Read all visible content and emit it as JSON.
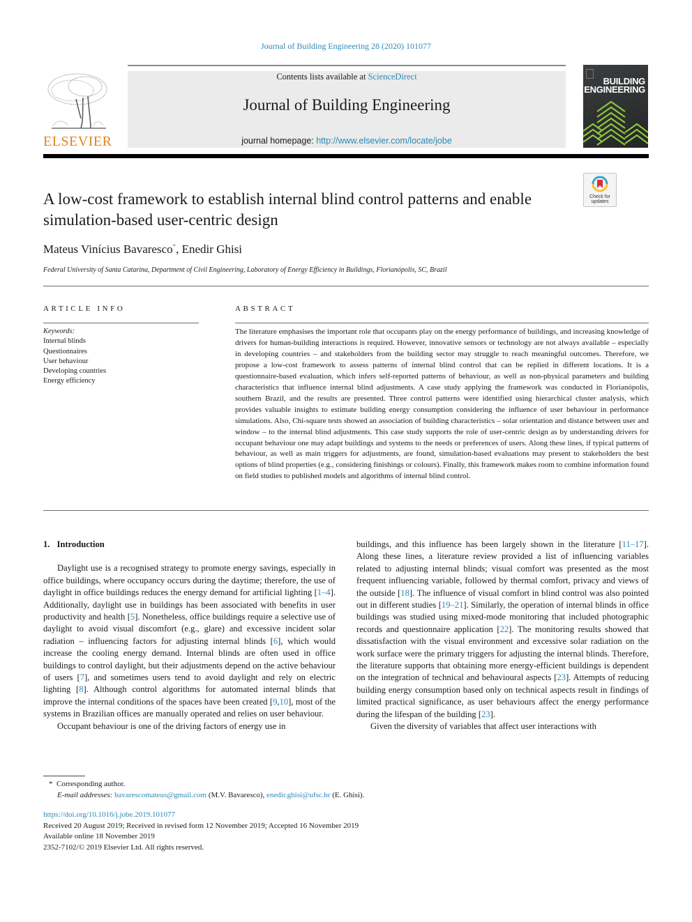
{
  "header": {
    "journal_reference": "Journal of Building Engineering 28 (2020) 101077",
    "publisher_logo": "ELSEVIER",
    "contents_prefix": "Contents lists available at ",
    "contents_link": "ScienceDirect",
    "journal_title": "Journal of Building Engineering",
    "homepage_prefix": "journal homepage: ",
    "homepage_url": "http://www.elsevier.com/locate/jobe",
    "cover_title_line1": "BUILDING",
    "cover_title_line2": "ENGINEERING",
    "crossmark_label_1": "Check for",
    "crossmark_label_2": "updates"
  },
  "article": {
    "title": "A low-cost framework to establish internal blind control patterns and enable simulation-based user-centric design",
    "authors": [
      {
        "name": "Mateus Vinícius Bavaresco",
        "mark": "*"
      },
      {
        "name": "Enedir Ghisi",
        "mark": ""
      }
    ],
    "author_separator": ", ",
    "affiliation": "Federal University of Santa Catarina, Department of Civil Engineering, Laboratory of Energy Efficiency in Buildings, Florianópolis, SC, Brazil"
  },
  "article_info": {
    "heading": "ARTICLE INFO",
    "keywords_label": "Keywords:",
    "keywords": [
      "Internal blinds",
      "Questionnaires",
      "User behaviour",
      "Developing countries",
      "Energy efficiency"
    ]
  },
  "abstract": {
    "heading": "ABSTRACT",
    "text": "The literature emphasises the important role that occupants play on the energy performance of buildings, and increasing knowledge of drivers for human-building interactions is required. However, innovative sensors or technology are not always available – especially in developing countries – and stakeholders from the building sector may struggle to reach meaningful outcomes. Therefore, we propose a low-cost framework to assess pat­terns of internal blind control that can be replied in different locations. It is a questionnaire-based evaluation, which infers self-reported patterns of behaviour, as well as non-physical parameters and building characteristics that influence internal blind adjustments. A case study applying the framework was conducted in Florianópolis, southern Brazil, and the results are presented. Three control patterns were identified using hierarchical cluster analysis, which provides valuable insights to estimate building energy consumption considering the influence of user behaviour in performance simulations. Also, Chi-square tests showed an association of building charac­teristics – solar orientation and distance between user and window – to the internal blind adjustments. This case study supports the role of user-centric design as by understanding drivers for occupant behaviour one may adapt buildings and systems to the needs or preferences of users. Along these lines, if typical patterns of behaviour, as well as main triggers for adjustments, are found, simulation-based evaluations may present to stakeholders the best options of blind properties (e.g., considering finishings or colours). Finally, this framework makes room to combine information found on field studies to published models and algorithms of internal blind control."
  },
  "introduction": {
    "section_number": "1.",
    "section_title": "Introduction",
    "paragraphs": [
      {
        "segments": [
          {
            "t": "Daylight use is a recognised strategy to promote energy savings, especially in office buildings, where occupancy occurs during the day­time; therefore, the use of daylight in office buildings reduces the energy demand for artificial lighting ["
          },
          {
            "t": "1–4",
            "ref": true
          },
          {
            "t": "]. Additionally, daylight use in buildings has been associated with benefits in user productivity and health ["
          },
          {
            "t": "5",
            "ref": true
          },
          {
            "t": "]. Nonetheless, office buildings require a selective use of daylight to avoid visual discomfort (e.g., glare) and excessive incident solar radiation – influencing factors for adjusting internal blinds ["
          },
          {
            "t": "6",
            "ref": true
          },
          {
            "t": "], which would increase the cooling energy demand. Internal blinds are often used in office buildings to control daylight, but their adjustments depend on the active behaviour of users ["
          },
          {
            "t": "7",
            "ref": true
          },
          {
            "t": "], and sometimes users tend to avoid daylight and rely on electric lighting ["
          },
          {
            "t": "8",
            "ref": true
          },
          {
            "t": "]. Although control algo­rithms for automated internal blinds that improve the internal condi­tions of the spaces have been created ["
          },
          {
            "t": "9",
            "ref": true
          },
          {
            "t": ","
          },
          {
            "t": "10",
            "ref": true
          },
          {
            "t": "], most of the systems in Brazilian offices are manually operated and relies on user behaviour."
          }
        ]
      },
      {
        "segments": [
          {
            "t": "Occupant behaviour is one of the driving factors of energy use in"
          }
        ]
      }
    ],
    "right_paragraphs": [
      {
        "continued": true,
        "segments": [
          {
            "t": "buildings, and this influence has been largely shown in the literature ["
          },
          {
            "t": "11–17",
            "ref": true
          },
          {
            "t": "]. Along these lines, a literature review provided a list of influ­encing variables related to adjusting internal blinds; visual comfort was presented as the most frequent influencing variable, followed by thermal comfort, privacy and views of the outside ["
          },
          {
            "t": "18",
            "ref": true
          },
          {
            "t": "]. The influence of visual comfort in blind control was also pointed out in different studies ["
          },
          {
            "t": "19–21",
            "ref": true
          },
          {
            "t": "]. Similarly, the operation of internal blinds in office buildings was studied using mixed-mode monitoring that included photographic records and questionnaire application ["
          },
          {
            "t": "22",
            "ref": true
          },
          {
            "t": "]. The monitoring results showed that dissatisfaction with the visual environment and excessive solar radiation on the work surface were the primary triggers for adjusting the internal blinds. Therefore, the literature supports that obtaining more energy-efficient buildings is dependent on the integra­tion of technical and behavioural aspects ["
          },
          {
            "t": "23",
            "ref": true
          },
          {
            "t": "]. Attempts of reducing building energy consumption based only on technical aspects result in findings of limited practical significance, as user behaviours affect the energy performance during the lifespan of the building ["
          },
          {
            "t": "23",
            "ref": true
          },
          {
            "t": "]."
          }
        ]
      },
      {
        "segments": [
          {
            "t": "Given the diversity of variables that affect user interactions with"
          }
        ]
      }
    ]
  },
  "footnotes": {
    "corresponding_mark": "*",
    "corresponding_text": "Corresponding author.",
    "email_label": "E-mail addresses:",
    "email_1": "bavarescomateus@gmail.com",
    "email_1_owner": " (M.V. Bavaresco), ",
    "email_2": "enedir.ghisi@ufsc.br",
    "email_2_owner": " (E. Ghisi)."
  },
  "article_meta": {
    "doi": "https://doi.org/10.1016/j.jobe.2019.101077",
    "history": "Received 20 August 2019; Received in revised form 12 November 2019; Accepted 16 November 2019",
    "available_online": "Available online 18 November 2019",
    "copyright": "2352-7102/© 2019 Elsevier Ltd. All rights reserved."
  },
  "colors": {
    "link": "#2a88b8",
    "elsevier_orange": "#e2821f",
    "header_box": "#ebebeb",
    "cover_green": "#8dc63f"
  }
}
